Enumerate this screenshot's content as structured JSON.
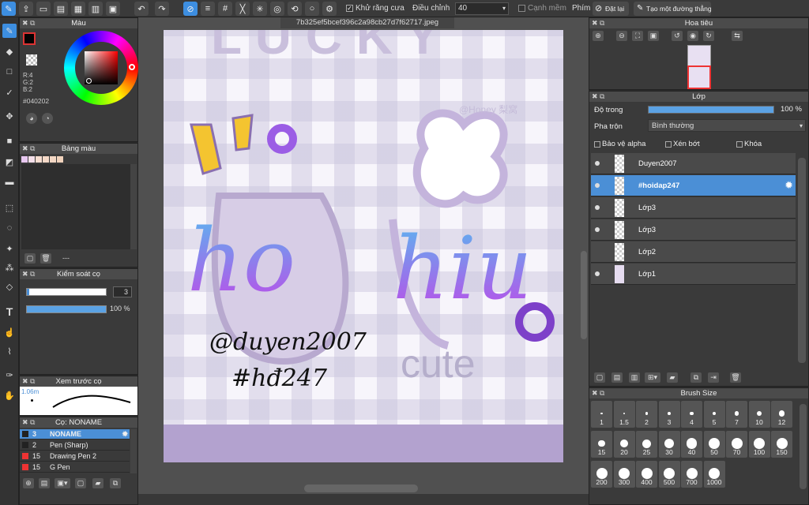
{
  "toolbar": {
    "antialias_label": "Khử răng cưa",
    "adjust_label": "Điều chỉnh",
    "adjust_value": "40",
    "snap_label": "Cạnh mềm",
    "key_label": "Phím",
    "reset_label": "Đặt lại",
    "line_label": "Tạo một đường thẳng"
  },
  "color_panel": {
    "title": "Màu",
    "r": "R:4",
    "g": "G:2",
    "b": "B:2",
    "hex": "#040202"
  },
  "palette_panel": {
    "title": "Bảng màu",
    "dash": "---",
    "swatches": [
      "#e8c8f0",
      "#f5e0ea",
      "#f7ddd0",
      "#f5d9c8",
      "#f3d7c4",
      "#f0d2bc"
    ]
  },
  "brush_control": {
    "title": "Kiểm soát cọ",
    "size_value": "3",
    "opacity_value": "100 %"
  },
  "brush_preview": {
    "title": "Xem trước cọ",
    "size_text": "1.06m"
  },
  "brush_list": {
    "title": "Cọ: NONAME",
    "items": [
      {
        "num": "3",
        "name": "NONAME"
      },
      {
        "num": "2",
        "name": "Pen (Sharp)"
      },
      {
        "num": "15",
        "name": "Drawing Pen 2"
      },
      {
        "num": "15",
        "name": "G Pen"
      }
    ]
  },
  "document": {
    "tab": "7b325ef5bcef396c2a98cb27d7f62717.jpeg"
  },
  "artwork": {
    "watermark": "@Honey 梨窝",
    "handwriting_1": "@duyen2007",
    "handwriting_2": "#hđ247"
  },
  "navigator": {
    "title": "Hoa tiêu"
  },
  "layers_panel": {
    "title": "Lớp",
    "opacity_label": "Độ trong",
    "opacity_value": "100 %",
    "opacity_fraction": 1.0,
    "blend_label": "Pha trộn",
    "blend_value": "Bình thường",
    "protect_alpha": "Bảo vệ alpha",
    "clip": "Xén bớt",
    "lock": "Khóa",
    "layers": [
      {
        "name": "Duyen2007"
      },
      {
        "name": "#hoidap247"
      },
      {
        "name": "Lớp3"
      },
      {
        "name": "Lớp3"
      },
      {
        "name": "Lớp2"
      },
      {
        "name": "Lớp1"
      }
    ]
  },
  "brush_size_panel": {
    "title": "Brush Size",
    "sizes": [
      "1",
      "1.5",
      "2",
      "3",
      "4",
      "5",
      "7",
      "10",
      "12",
      "15",
      "20",
      "25",
      "30",
      "40",
      "50",
      "70",
      "100",
      "150",
      "200",
      "300",
      "400",
      "500",
      "700",
      "1000"
    ]
  }
}
